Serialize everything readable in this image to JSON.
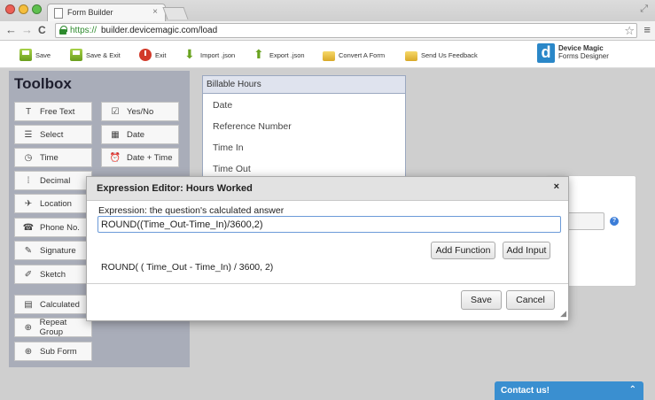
{
  "browser": {
    "tab_title": "Form Builder",
    "tab_close": "×",
    "url_scheme": "https://",
    "url_rest": "builder.devicemagic.com/load",
    "nav_back": "←",
    "nav_forward": "→",
    "nav_reload": "C",
    "star": "☆",
    "menu": "≡",
    "resize": "⤢"
  },
  "app_toolbar": {
    "items": [
      {
        "label": "Save",
        "icon": "save-icon"
      },
      {
        "label": "Save & Exit",
        "icon": "save-icon"
      },
      {
        "label": "Exit",
        "icon": "power-icon"
      },
      {
        "label": "Import .json",
        "icon": "download-arrow-icon"
      },
      {
        "label": "Export .json",
        "icon": "upload-arrow-icon"
      },
      {
        "label": "Convert A Form",
        "icon": "folder-icon"
      },
      {
        "label": "Send Us Feedback",
        "icon": "folder-icon"
      }
    ],
    "logo_mark": "d",
    "logo_line1": "Device Magic",
    "logo_line2": "Forms Designer"
  },
  "toolbox": {
    "title": "Toolbox",
    "tools": [
      {
        "label": "Free Text",
        "glyph": "T"
      },
      {
        "label": "Yes/No",
        "glyph": "☑"
      },
      {
        "label": "Select",
        "glyph": "☰"
      },
      {
        "label": "Date",
        "glyph": "▦"
      },
      {
        "label": "Time",
        "glyph": "◷"
      },
      {
        "label": "Date + Time",
        "glyph": "⏰"
      },
      {
        "label": "Decimal",
        "glyph": "⁞"
      },
      {
        "label": "Location",
        "glyph": "✈"
      },
      {
        "label": "Phone No.",
        "glyph": "☎"
      },
      {
        "label": "Signature",
        "glyph": "✎"
      },
      {
        "label": "Sketch",
        "glyph": "✐"
      },
      {
        "label": "Calculated",
        "glyph": "▤"
      },
      {
        "label": "Repeat Group",
        "glyph": "⊕"
      },
      {
        "label": "Sub Form",
        "glyph": "⊕"
      }
    ]
  },
  "form": {
    "header": "Billable Hours",
    "items": [
      "Date",
      "Reference Number",
      "Time In",
      "Time Out"
    ]
  },
  "properties": {
    "help": "?"
  },
  "modal": {
    "title": "Expression Editor: Hours Worked",
    "close": "×",
    "label": "Expression: the question's calculated answer",
    "value": "ROUND((Time_Out-Time_In)/3600,2)",
    "add_function": "Add Function",
    "add_input": "Add Input",
    "preview": "ROUND( ( Time_Out - Time_In) / 3600, 2)",
    "save": "Save",
    "cancel": "Cancel",
    "grip": "◢"
  },
  "contact": {
    "label": "Contact us!",
    "chevron": "⌃"
  }
}
